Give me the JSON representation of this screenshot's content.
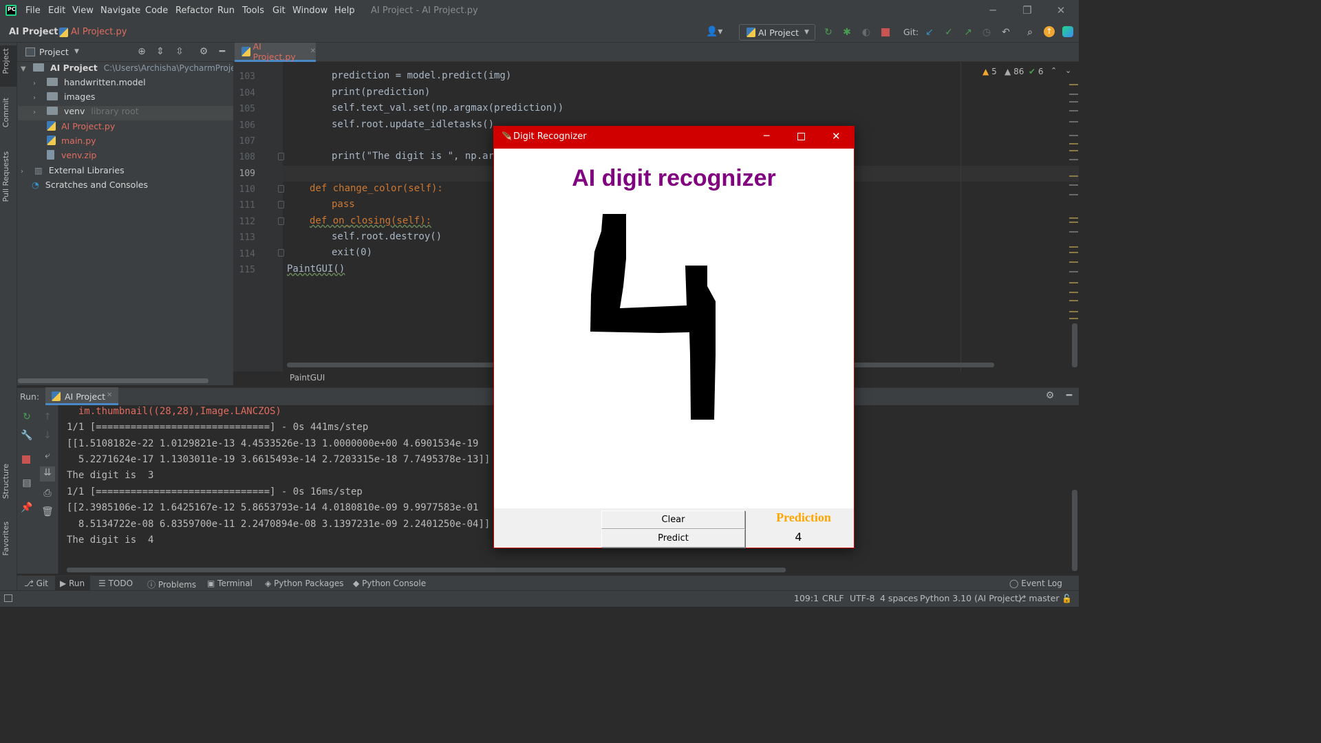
{
  "menubar": {
    "items": [
      "File",
      "Edit",
      "View",
      "Navigate",
      "Code",
      "Refactor",
      "Run",
      "Tools",
      "Git",
      "Window",
      "Help"
    ],
    "window_title": "AI Project - AI Project.py"
  },
  "navbar": {
    "project": "AI Project",
    "file": "AI Project.py",
    "run_config": "AI Project",
    "git_label": "Git:"
  },
  "left_stripe": {
    "project": "Project",
    "commit": "Commit",
    "pull_requests": "Pull Requests",
    "structure": "Structure",
    "favorites": "Favorites"
  },
  "project_panel": {
    "title": "Project",
    "root_name": "AI Project",
    "root_path": "C:\\Users\\Archisha\\PycharmProjects\\AI Pr",
    "items": [
      {
        "name": "handwritten.model",
        "kind": "folder"
      },
      {
        "name": "images",
        "kind": "folder"
      },
      {
        "name": "venv",
        "kind": "folder",
        "suffix": "library root"
      },
      {
        "name": "AI Project.py",
        "kind": "py"
      },
      {
        "name": "main.py",
        "kind": "py"
      },
      {
        "name": "venv.zip",
        "kind": "zip"
      }
    ],
    "external_libraries": "External Libraries",
    "scratches": "Scratches and Consoles"
  },
  "editor": {
    "tab": "AI Project.py",
    "inspections": {
      "warnings": "5",
      "weak_warnings": "86",
      "ok": "6"
    },
    "breadcrumb": "PaintGUI",
    "lines": [
      {
        "n": "103",
        "code": "prediction = model.predict(img)"
      },
      {
        "n": "104",
        "code": "print(prediction)"
      },
      {
        "n": "105",
        "code": "self.text_val.set(np.argmax(prediction))"
      },
      {
        "n": "106",
        "code": "self.root.update_idletasks()"
      },
      {
        "n": "107",
        "code": ""
      },
      {
        "n": "108",
        "code": "print(\"The digit is \", np.arg"
      },
      {
        "n": "109",
        "code": ""
      },
      {
        "n": "110",
        "code": "def change_color(self):"
      },
      {
        "n": "111",
        "code": "pass"
      },
      {
        "n": "112",
        "code": "def on_closing(self):"
      },
      {
        "n": "113",
        "code": "self.root.destroy()"
      },
      {
        "n": "114",
        "code": "exit(0)"
      },
      {
        "n": "115",
        "code": "PaintGUI()"
      }
    ]
  },
  "run": {
    "label": "Run:",
    "tab": "AI Project",
    "output": [
      "  im.thumbnail((28,28),Image.LANCZOS)",
      "1/1 [==============================] - 0s 441ms/step",
      "[[1.5108182e-22 1.0129821e-13 4.4533526e-13 1.0000000e+00 4.6901534e-19",
      "  5.2271624e-17 1.1303011e-19 3.6615493e-14 2.7203315e-18 7.7495378e-13]]",
      "The digit is  3",
      "1/1 [==============================] - 0s 16ms/step",
      "[[2.3985106e-12 1.6425167e-12 5.8653793e-14 4.0180810e-09 9.9977583e-01",
      "  8.5134722e-08 6.8359700e-11 2.2470894e-08 3.1397231e-09 2.2401250e-04]]",
      "The digit is  4"
    ]
  },
  "bottom_tools": [
    "Git",
    "Run",
    "TODO",
    "Problems",
    "Terminal",
    "Python Packages",
    "Python Console"
  ],
  "event_log": "Event Log",
  "status": {
    "position": "109:1",
    "line_sep": "CRLF",
    "encoding": "UTF-8",
    "indent": "4 spaces",
    "interpreter": "Python 3.10 (AI Project)",
    "branch": "master"
  },
  "digit_window": {
    "title": "Digit Recognizer",
    "heading": "AI digit recognizer",
    "clear": "Clear",
    "predict": "Predict",
    "prediction_label": "Prediction",
    "prediction_value": "4",
    "heading_color": "#800080",
    "prediction_label_color": "#ffa500"
  }
}
